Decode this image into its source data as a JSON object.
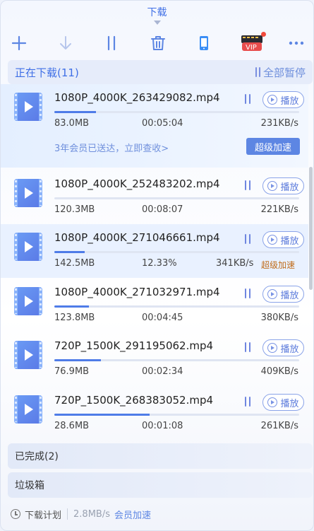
{
  "header": {
    "title": "下载"
  },
  "toolbar": {
    "add_icon": "plus-icon",
    "download_icon": "arrow-down-icon",
    "pause_icon": "pause-icon",
    "delete_icon": "trash-icon",
    "phone_icon": "phone-icon",
    "vip_label": "VIP",
    "more_icon": "more-dots-icon"
  },
  "downloading": {
    "title": "正在下载(11)",
    "pause_all": "全部暂停"
  },
  "items": [
    {
      "name": "1080P_4000K_263429082.mp4",
      "size": "83.0MB",
      "status": "00:05:04",
      "speed": "231KB/s",
      "progress": 0.17,
      "play": "播放"
    },
    {
      "name": "1080P_4000K_252483202.mp4",
      "size": "120.3MB",
      "status": "00:08:07",
      "speed": "221KB/s",
      "progress": 0.0,
      "play": "播放"
    },
    {
      "name": "1080P_4000K_271046661.mp4",
      "size": "142.5MB",
      "status": "12.33%",
      "speed": "341KB/s",
      "progress": 0.1233,
      "play": "播放",
      "extra": "超级加速"
    },
    {
      "name": "1080P_4000K_271032971.mp4",
      "size": "123.8MB",
      "status": "00:04:45",
      "speed": "380KB/s",
      "progress": 0.14,
      "play": "播放"
    },
    {
      "name": "720P_1500K_291195062.mp4",
      "size": "76.9MB",
      "status": "00:02:34",
      "speed": "409KB/s",
      "progress": 0.19,
      "play": "播放"
    },
    {
      "name": "720P_1500K_268383052.mp4",
      "size": "28.6MB",
      "status": "00:01:08",
      "speed": "261KB/s",
      "progress": 0.39,
      "play": "播放"
    }
  ],
  "promo": {
    "text": "3年会员已送达，立即查收>",
    "button": "超级加速"
  },
  "groups": {
    "completed": "已完成(2)",
    "trash": "垃圾箱"
  },
  "footer": {
    "plan": "下载计划",
    "rate": "2.8MB/s",
    "vip": "会员加速"
  },
  "colors": {
    "accent": "#3f6fe6",
    "progress": "#4f7ce8",
    "vip": "#f24a3c",
    "speedup": "#c06d1b"
  }
}
